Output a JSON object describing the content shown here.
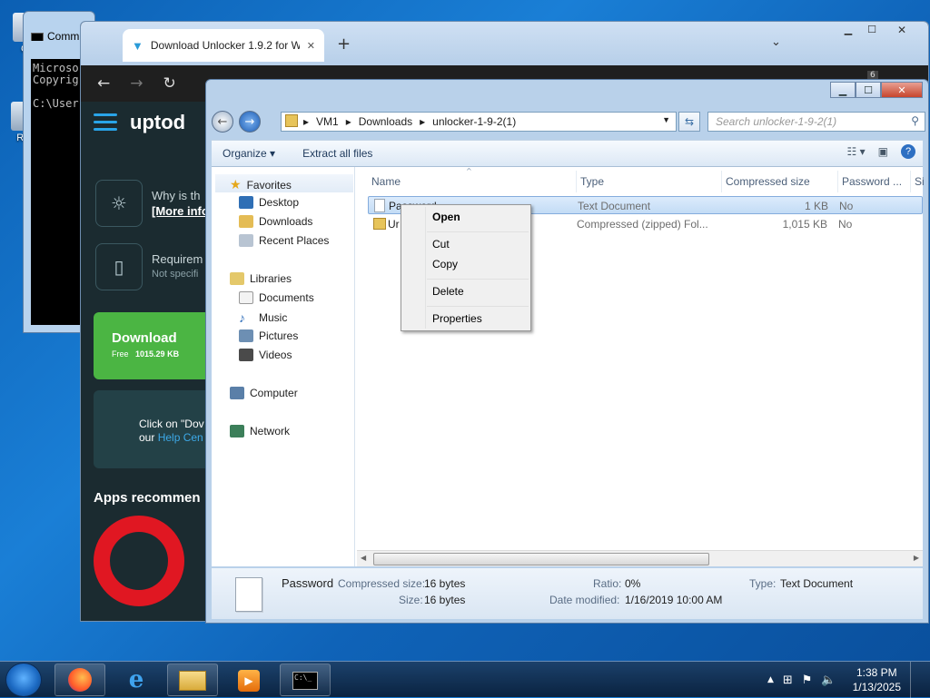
{
  "desktop": {
    "icons": [
      {
        "label": "Co"
      },
      {
        "label": "Rec"
      }
    ]
  },
  "cmd": {
    "title": "Comm",
    "lines": [
      "Microso",
      "Copyrig",
      "",
      "C:\\User"
    ]
  },
  "browser": {
    "tab_title": "Download Unlocker 1.9.2 for Wi",
    "tab_close": "✕",
    "new_tab": "+",
    "tab_count": "6",
    "brand": "uptod",
    "why_title": "Why is th",
    "why_link": "[More info",
    "req_title": "Requirem",
    "req_sub": "Not specifi",
    "download_label": "Download",
    "download_free": "Free",
    "download_size": "1015.29 KB",
    "help_line1": "Click on \"Dov",
    "help_line2_prefix": "our ",
    "help_line2_link": "Help Cen",
    "apps_recommended": "Apps recommen"
  },
  "explorer": {
    "address": {
      "crumbs": [
        "VM1",
        "Downloads",
        "unlocker-1-9-2(1)"
      ]
    },
    "search_placeholder": "Search unlocker-1-9-2(1)",
    "toolbar": {
      "organize": "Organize",
      "extract_all": "Extract all files"
    },
    "nav": {
      "favorites": "Favorites",
      "desktop": "Desktop",
      "downloads": "Downloads",
      "recent_places": "Recent Places",
      "libraries": "Libraries",
      "documents": "Documents",
      "music": "Music",
      "pictures": "Pictures",
      "videos": "Videos",
      "computer": "Computer",
      "network": "Network"
    },
    "columns": {
      "name": "Name",
      "type": "Type",
      "compressed_size": "Compressed size",
      "password": "Password ...",
      "size": "Si"
    },
    "files": [
      {
        "name": "Password",
        "type": "Text Document",
        "compressed_size": "1 KB",
        "password": "No"
      },
      {
        "name": "Ur",
        "type": "Compressed (zipped) Fol...",
        "compressed_size": "1,015 KB",
        "password": "No"
      }
    ],
    "details": {
      "name": "Password",
      "compressed_size_label": "Compressed size:",
      "compressed_size_value": "16 bytes",
      "size_label": "Size:",
      "size_value": "16 bytes",
      "ratio_label": "Ratio:",
      "ratio_value": "0%",
      "date_label": "Date modified:",
      "date_value": "1/16/2019 10:00 AM",
      "type_label": "Type:",
      "type_value": "Text Document"
    }
  },
  "context_menu": {
    "open": "Open",
    "cut": "Cut",
    "copy": "Copy",
    "delete": "Delete",
    "properties": "Properties"
  },
  "taskbar": {
    "time": "1:38 PM",
    "date": "1/13/2025"
  },
  "colors": {
    "desktop_blue": "#1a7fd6",
    "download_green": "#4bb543",
    "opera_red": "#e01722",
    "selection_blue": "#c3dcf5"
  }
}
